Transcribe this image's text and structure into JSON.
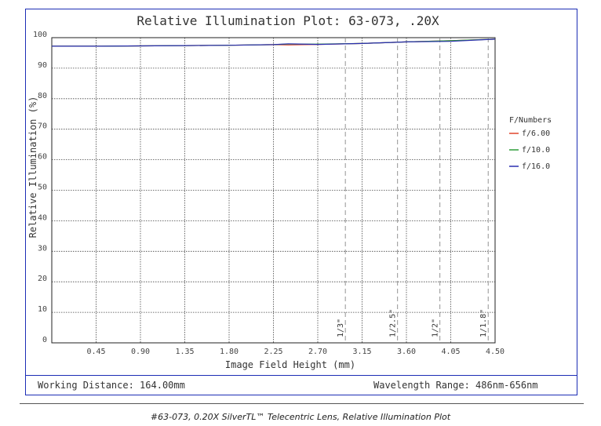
{
  "chart_data": {
    "type": "line",
    "title": "Relative Illumination Plot: 63-073, .20X",
    "xlabel": "Image Field Height (mm)",
    "ylabel": "Relative Illumination (%)",
    "xlim": [
      0,
      4.5
    ],
    "ylim": [
      0,
      100
    ],
    "x_ticks": [
      "0.45",
      "0.90",
      "1.35",
      "1.80",
      "2.25",
      "2.70",
      "3.15",
      "3.60",
      "4.05",
      "4.50"
    ],
    "y_ticks": [
      "0",
      "10",
      "20",
      "30",
      "40",
      "50",
      "60",
      "70",
      "80",
      "90",
      "100"
    ],
    "grid": true,
    "legend_title": "F/Numbers",
    "legend_position": "right",
    "series": [
      {
        "name": "f/6.00",
        "color": "#e0452c",
        "x": [
          0,
          0.45,
          0.9,
          1.35,
          1.8,
          2.25,
          2.4,
          2.7,
          3.15,
          3.6,
          4.05,
          4.5
        ],
        "y": [
          97.2,
          97.2,
          97.3,
          97.4,
          97.5,
          97.7,
          97.6,
          97.8,
          98.1,
          98.6,
          99.0,
          99.5
        ]
      },
      {
        "name": "f/10.0",
        "color": "#2e9e3a",
        "x": [
          0,
          0.45,
          0.9,
          1.35,
          1.8,
          2.25,
          2.4,
          2.7,
          3.15,
          3.6,
          4.05,
          4.5
        ],
        "y": [
          97.2,
          97.2,
          97.3,
          97.4,
          97.5,
          97.7,
          97.9,
          97.9,
          98.1,
          98.6,
          99.0,
          99.5
        ]
      },
      {
        "name": "f/16.0",
        "color": "#2b2fb0",
        "x": [
          0,
          0.45,
          0.9,
          1.35,
          1.8,
          2.25,
          2.4,
          2.7,
          3.15,
          3.6,
          4.05,
          4.5
        ],
        "y": [
          97.2,
          97.2,
          97.3,
          97.4,
          97.5,
          97.7,
          98.0,
          97.8,
          98.1,
          98.6,
          98.8,
          99.5
        ]
      }
    ],
    "sensor_markers": [
      {
        "label": "1/3\"",
        "x": 2.98
      },
      {
        "label": "1/2.5\"",
        "x": 3.51
      },
      {
        "label": "1/2\"",
        "x": 3.94
      },
      {
        "label": "1/1.8\"",
        "x": 4.43
      }
    ]
  },
  "footer": {
    "working_distance": "Working Distance: 164.00mm",
    "wavelength_range": "Wavelength Range: 486nm-656nm"
  },
  "caption": "#63-073, 0.20X SilverTL™ Telecentric Lens, Relative Illumination Plot"
}
